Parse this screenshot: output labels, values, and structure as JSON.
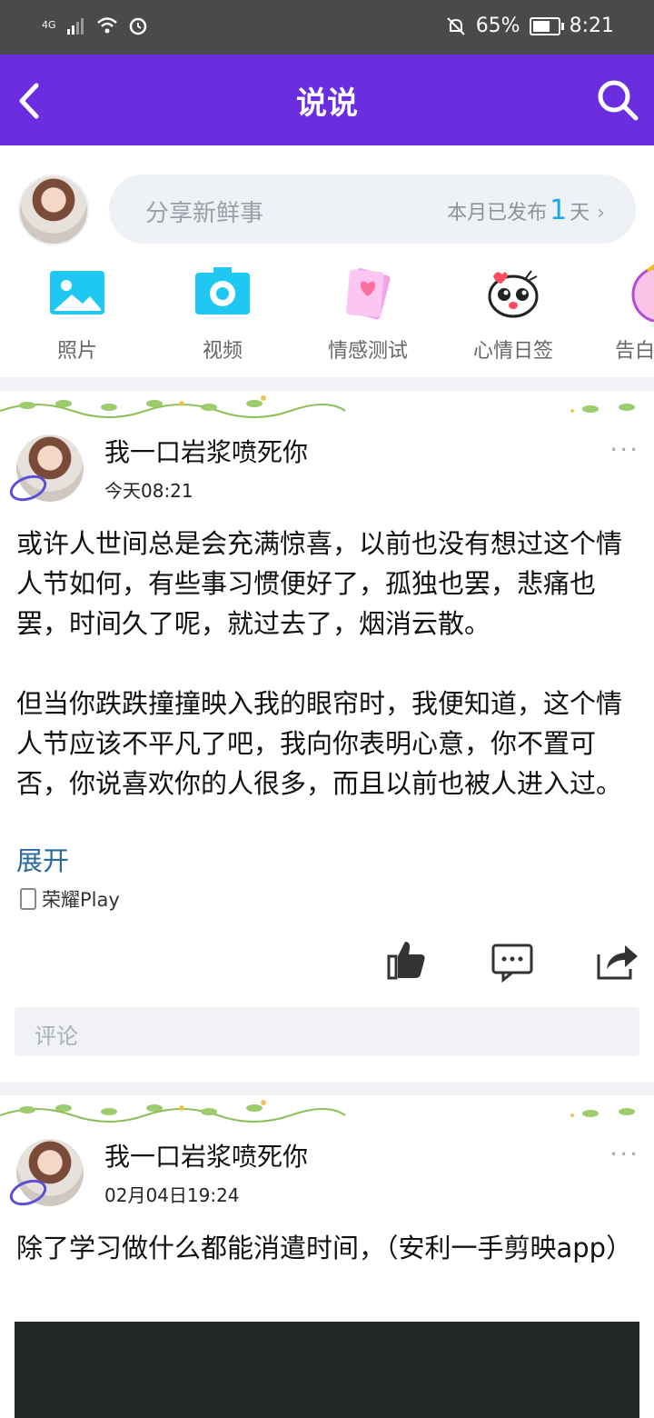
{
  "status_bar": {
    "network": "4G",
    "battery": "65%",
    "time": "8:21"
  },
  "nav": {
    "title": "说说"
  },
  "composer": {
    "placeholder": "分享新鲜事",
    "month_prefix": "本月已发布",
    "month_count": "1",
    "month_suffix": "天"
  },
  "quick_actions": [
    {
      "label": "照片",
      "icon": "photo-icon"
    },
    {
      "label": "视频",
      "icon": "video-camera-icon"
    },
    {
      "label": "情感测试",
      "icon": "love-card-icon"
    },
    {
      "label": "心情日签",
      "icon": "emoji-face-icon"
    },
    {
      "label": "告白",
      "icon": "confession-icon"
    }
  ],
  "posts": [
    {
      "author": "我一口岩浆喷死你",
      "time": "今天08:21",
      "more": "···",
      "text": "或许人世间总是会充满惊喜，以前也没有想过这个情人节如何，有些事习惯便好了，孤独也罢，悲痛也罢，时间久了呢，就过去了，烟消云散。\n\n但当你跌跌撞撞映入我的眼帘时，我便知道，这个情人节应该不平凡了吧，我向你表明心意，你不置可否，你说喜欢你的人很多，而且以前也被人进入过。",
      "expand": "展开",
      "device": "荣耀Play",
      "comment_placeholder": "评论"
    },
    {
      "author": "我一口岩浆喷死你",
      "time": "02月04日19:24",
      "more": "···",
      "text": "除了学习做什么都能消遣时间，（安利一手剪映app）"
    }
  ],
  "colors": {
    "nav_bg": "#6a2ee0",
    "status_bg": "#4a4a4a",
    "accent_blue": "#19a7ee",
    "link": "#2a6aa0"
  }
}
